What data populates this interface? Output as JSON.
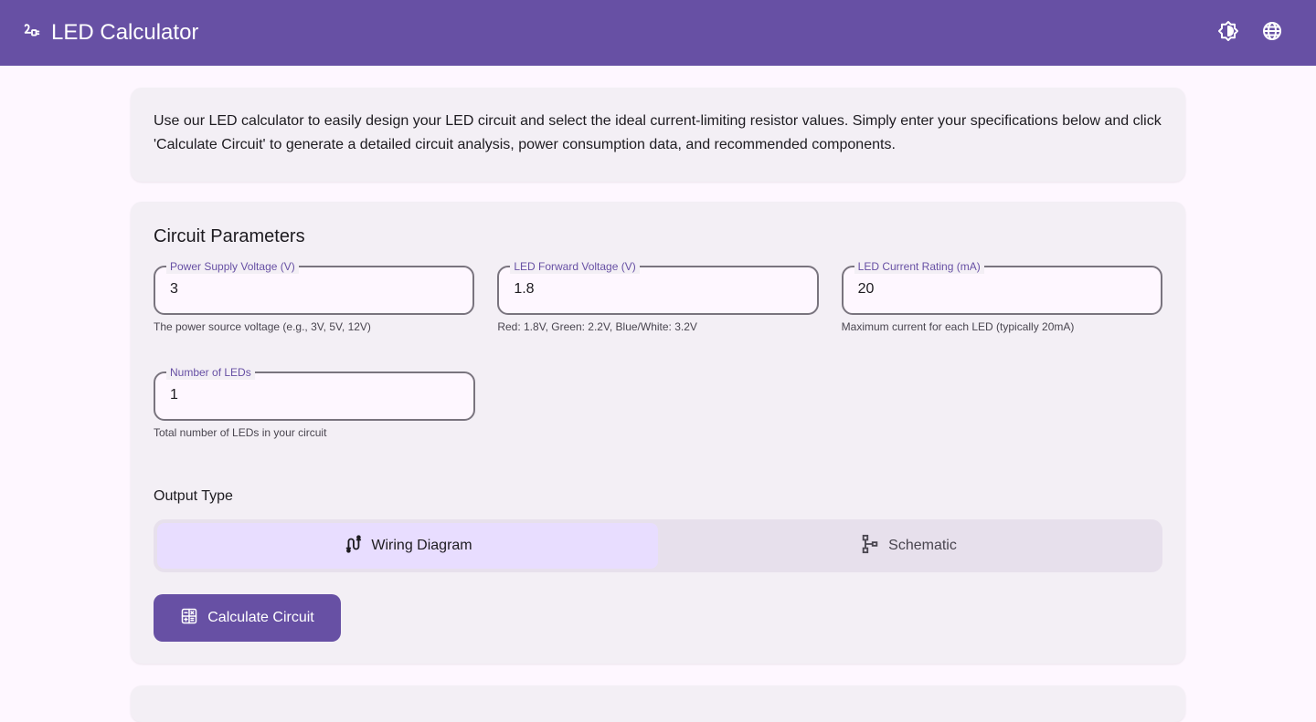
{
  "app": {
    "title": "LED Calculator",
    "icons": {
      "brand": "power-plug-icon",
      "theme": "brightness-icon",
      "language": "globe-icon"
    }
  },
  "intro": {
    "text": "Use our LED calculator to easily design your LED circuit and select the ideal current-limiting resistor values. Simply enter your specifications below and click 'Calculate Circuit' to generate a detailed circuit analysis, power consumption data, and recommended components."
  },
  "params": {
    "title": "Circuit Parameters",
    "fields": [
      {
        "label": "Power Supply Voltage (V)",
        "value": "3",
        "hint": "The power source voltage (e.g., 3V, 5V, 12V)"
      },
      {
        "label": "LED Forward Voltage (V)",
        "value": "1.8",
        "hint": "Red: 1.8V, Green: 2.2V, Blue/White: 3.2V"
      },
      {
        "label": "LED Current Rating (mA)",
        "value": "20",
        "hint": "Maximum current for each LED (typically 20mA)"
      },
      {
        "label": "Number of LEDs",
        "value": "1",
        "hint": "Total number of LEDs in your circuit"
      }
    ],
    "output_type": {
      "label": "Output Type",
      "options": [
        {
          "label": "Wiring Diagram",
          "icon": "wiring-icon",
          "selected": true
        },
        {
          "label": "Schematic",
          "icon": "schematic-icon",
          "selected": false
        }
      ]
    },
    "calculate_label": "Calculate Circuit"
  },
  "colors": {
    "primary": "#6750a4",
    "surface": "#f3eff5",
    "background": "#fef7ff",
    "selected_segment": "#e8ddff"
  }
}
